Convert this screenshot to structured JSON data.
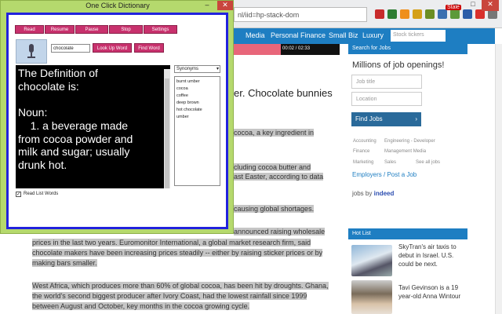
{
  "browser": {
    "url": "nl/iid=hp-stack-dom",
    "ext_badge": "Stale",
    "caption": {
      "min": "–",
      "max": "□",
      "close": "✕"
    },
    "nav": [
      "Media",
      "Personal Finance",
      "Small Biz",
      "Luxury"
    ],
    "search_placeholder": "Stock tickers",
    "player_time": "00:02 / 02:33",
    "article": {
      "headline": "er. Chocolate bunnies",
      "lines": [
        "cocoa, a key ingredient in",
        "cluding cocoa butter and",
        "ast Easter, according to data",
        "causing global shortages.",
        "announced raising wholesale",
        "prices in the last two years. Euromonitor International, a global market research firm, said",
        "chocolate makers have been increasing prices steadily -- either by raising sticker prices or by",
        "making bars smaller.",
        "West Africa, which produces more than 60% of global cocoa, has been hit by droughts. Ghana,",
        "the world's second biggest producer after Ivory Coast, had the lowest rainfall since 1999",
        "between August and October, key months in the cocoa growing cycle."
      ]
    },
    "jobs": {
      "header": "Search for Jobs",
      "subtitle": "Millions of job openings!",
      "job_title_placeholder": "Job title",
      "location_placeholder": "Location",
      "find_button": "Find Jobs",
      "categories": [
        "Accounting",
        "Engineering - Developer",
        "Finance",
        "Management Media",
        "Marketing",
        "Sales",
        "See all jobs"
      ],
      "employers_link": "Employers / Post a Job",
      "jobs_by": "jobs by",
      "jobs_brand": "indeed"
    },
    "hotlist": {
      "header": "Hot List",
      "item1": [
        "SkyTran's air taxis to",
        "debut in Israel. U.S.",
        "could be next."
      ],
      "item2": [
        "Tavi Gevinson is a 19",
        "year-old Anna Wintour"
      ]
    }
  },
  "dict": {
    "title": "One Click Dictionary",
    "min": "–",
    "close": "✕",
    "toolbar": [
      "Read",
      "Resume",
      "Pause",
      "Stop",
      "Settings"
    ],
    "word": "chocolate",
    "lookup_button": "Look Up Word",
    "find_button": "Find Word",
    "definition": "The Definition of\nchocolate is:\n\nNoun:\n    1. a beverage made\nfrom cocoa powder and\nmilk and sugar; usually\ndrunk hot.",
    "synonyms_select": "Synonyms",
    "synonyms": [
      "burnt umber",
      "cocoa",
      "coffee",
      "deep brown",
      "hot chocolate",
      "umber"
    ],
    "read_list_checked": "✓",
    "read_list_label": "Read List Words"
  },
  "colors": {
    "dict_frame": "#b5d96d",
    "dict_border": "#2222dd",
    "button": "#c8316d",
    "site_blue": "#1e7ec2"
  }
}
